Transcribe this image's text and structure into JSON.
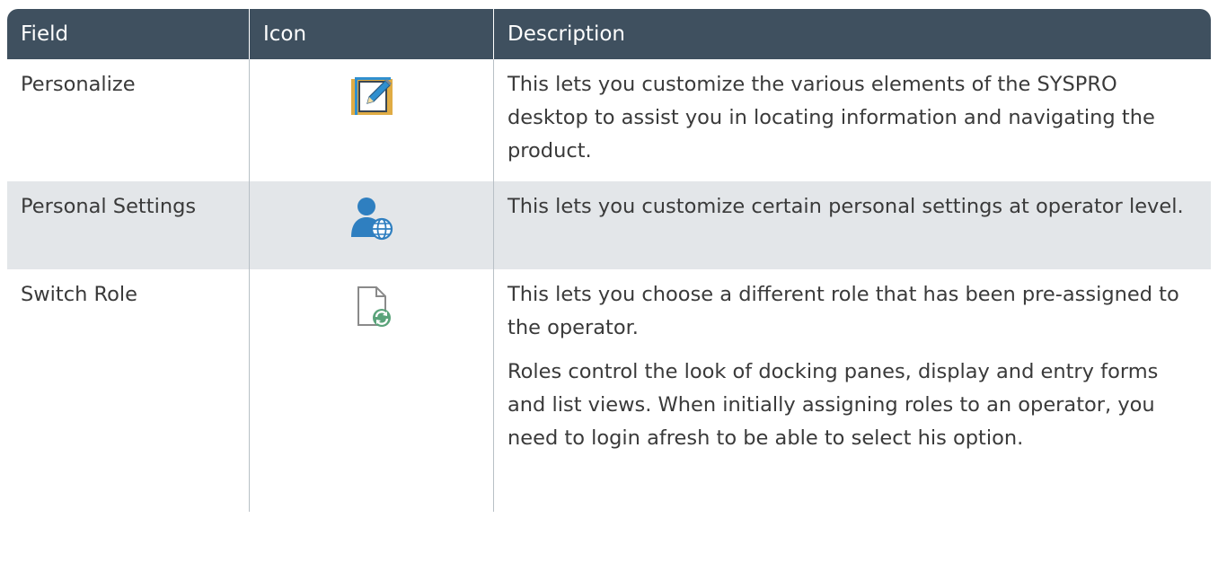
{
  "table": {
    "headers": {
      "field": "Field",
      "icon": "Icon",
      "description": "Description"
    },
    "rows": [
      {
        "field": "Personalize",
        "icon": "personalize-edit-icon",
        "description": [
          "This lets you customize the various elements of the SYSPRO desktop to assist you in locating information and navigating the product."
        ]
      },
      {
        "field": "Personal Settings",
        "icon": "personal-settings-user-globe-icon",
        "description": [
          "This lets you customize certain personal settings at operator level."
        ]
      },
      {
        "field": "Switch Role",
        "icon": "switch-role-document-refresh-icon",
        "description": [
          "This lets you choose a different role that has been pre-assigned to the operator.",
          "Roles control the look of docking panes, display and entry forms and list views. When initially assigning roles to an operator, you need to login afresh to be able to select his option."
        ]
      }
    ]
  },
  "colors": {
    "header_bg": "#3f505f",
    "header_text": "#ffffff",
    "alt_row_bg": "#e3e6e9",
    "body_text": "#3a3a3a"
  }
}
